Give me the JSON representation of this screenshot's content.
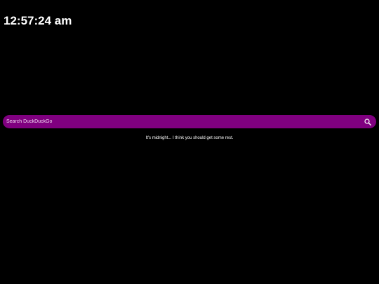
{
  "clock": {
    "time": "12:57:24 am"
  },
  "search": {
    "placeholder": "Search DuckDuckGo",
    "value": "",
    "button_icon": "search-icon"
  },
  "message": {
    "text": "It's midnight... I think you should get some rest."
  },
  "colors": {
    "background": "#000000",
    "search_bar": "#800080",
    "text": "#ffffff"
  }
}
